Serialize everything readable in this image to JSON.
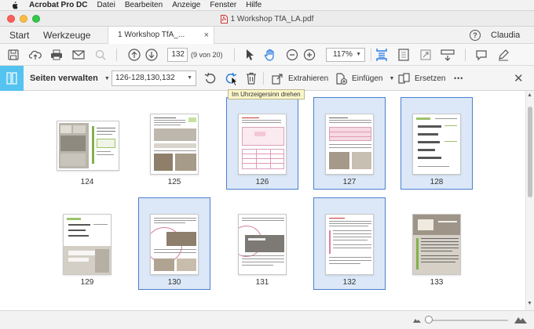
{
  "menubar": {
    "app": "Acrobat Pro DC",
    "items": [
      "Datei",
      "Bearbeiten",
      "Anzeige",
      "Fenster",
      "Hilfe"
    ]
  },
  "window": {
    "title": "1 Workshop TfA_LA.pdf"
  },
  "tabs": {
    "start": "Start",
    "tools": "Werkzeuge",
    "document": "1 Workshop TfA_...",
    "close": "×",
    "help": "?",
    "user": "Claudia"
  },
  "toolbar": {
    "page_number": "132",
    "page_count": "(9 von 20)",
    "zoom": "117%"
  },
  "organize": {
    "title": "Seiten verwalten",
    "page_range": "126-128,130,132",
    "extract": "Extrahieren",
    "insert": "Einfügen",
    "replace": "Ersetzen",
    "more": "•••",
    "close": "✕"
  },
  "tooltip": "Im Uhrzeigersinn drehen",
  "pages": [
    {
      "label": "124",
      "selected": false
    },
    {
      "label": "125",
      "selected": false
    },
    {
      "label": "126",
      "selected": true
    },
    {
      "label": "127",
      "selected": true
    },
    {
      "label": "128",
      "selected": true
    },
    {
      "label": "129",
      "selected": false
    },
    {
      "label": "130",
      "selected": true
    },
    {
      "label": "131",
      "selected": false
    },
    {
      "label": "132",
      "selected": true
    },
    {
      "label": "133",
      "selected": false
    }
  ],
  "colors": {
    "selection_fill": "#dce8f7",
    "selection_border": "#4a7fd0",
    "accent_blue": "#2a7de1",
    "organize_icon_bg": "#55c3f0",
    "tooltip_bg": "#fbf6c9"
  }
}
